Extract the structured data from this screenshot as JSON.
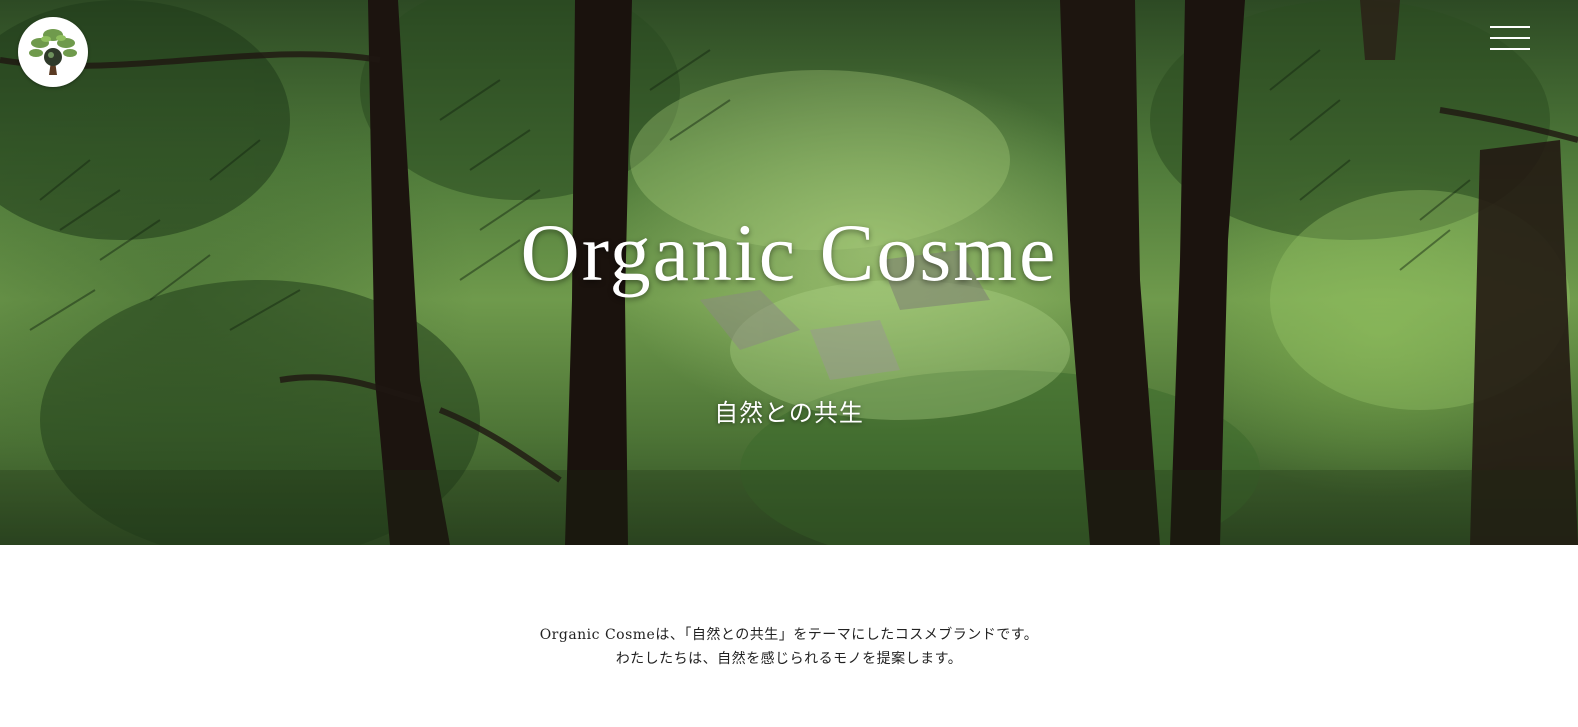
{
  "header": {
    "logo_icon": "tree-globe-icon",
    "menu_icon": "hamburger-icon"
  },
  "hero": {
    "title": "Organic Cosme",
    "subtitle": "自然との共生"
  },
  "intro": {
    "line1": "Organic Cosmeは、「自然との共生」をテーマにしたコスメブランドです。",
    "line2": "わたしたちは、自然を感じられるモノを提案します。"
  },
  "colors": {
    "text_on_hero": "#ffffff",
    "body_text": "#222222",
    "forest_dark": "#2d4a24",
    "forest_light": "#8fbf5e"
  }
}
